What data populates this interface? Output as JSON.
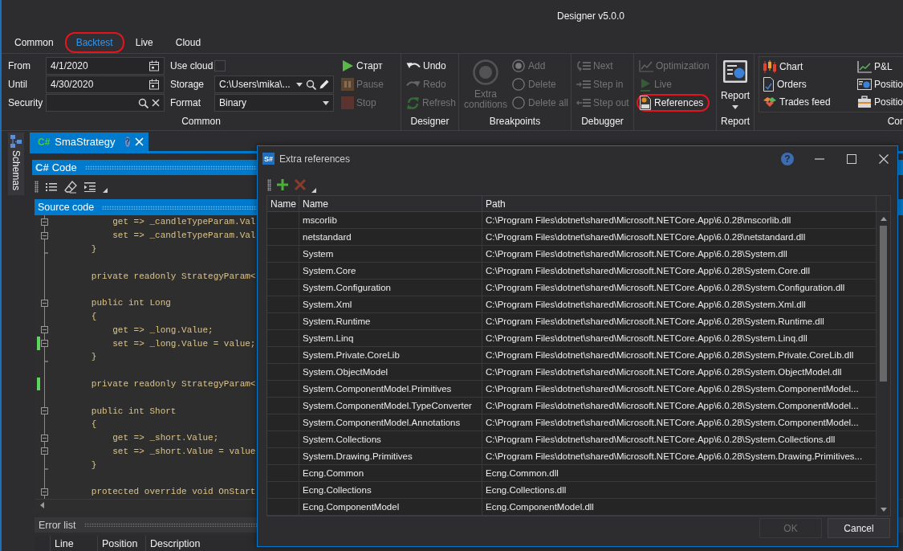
{
  "window": {
    "title": "Designer v5.0.0"
  },
  "ribbon": {
    "tabs": [
      {
        "label": "Common",
        "selected": false,
        "highlighted": false
      },
      {
        "label": "Backtest",
        "selected": true,
        "highlighted": true
      },
      {
        "label": "Live",
        "selected": false,
        "highlighted": false
      },
      {
        "label": "Cloud",
        "selected": false,
        "highlighted": false
      }
    ],
    "groups": [
      {
        "kind": "settings",
        "label": "Common",
        "fields": [
          {
            "label": "From",
            "kind": "date",
            "value": "4/1/2020"
          },
          {
            "label": "Until",
            "kind": "date",
            "value": "4/30/2020"
          },
          {
            "label": "Security",
            "kind": "lookup"
          }
        ],
        "options": [
          {
            "label": "Use cloud",
            "kind": "checkbox",
            "checked": false
          },
          {
            "label": "Storage",
            "kind": "path",
            "value": "C:\\Users\\mika\\..."
          },
          {
            "label": "Format",
            "kind": "dropdown",
            "value": "Binary"
          }
        ],
        "buttons": [
          {
            "label": "Старт",
            "disabled": false,
            "highlighted": false
          },
          {
            "label": "Pause",
            "disabled": true,
            "highlighted": false
          },
          {
            "label": "Stop",
            "disabled": true,
            "highlighted": false
          }
        ]
      },
      {
        "kind": "commands",
        "label": "Designer",
        "buttons": [
          {
            "label": "Undo",
            "disabled": false,
            "highlighted": false
          },
          {
            "label": "Redo",
            "disabled": true,
            "highlighted": false
          },
          {
            "label": "Refresh",
            "disabled": true,
            "highlighted": false
          }
        ]
      },
      {
        "kind": "breakpoints",
        "label": "Breakpoints",
        "large_button": {
          "label": "Extra conditions",
          "disabled": true
        },
        "radios": [
          {
            "label": "Add",
            "selected": true,
            "disabled": true
          },
          {
            "label": "Delete",
            "selected": false,
            "disabled": true
          },
          {
            "label": "Delete all",
            "selected": false,
            "disabled": true
          }
        ]
      },
      {
        "kind": "commands",
        "label": "Debugger",
        "buttons": [
          {
            "label": "Next",
            "disabled": true,
            "highlighted": false
          },
          {
            "label": "Step in",
            "disabled": true,
            "highlighted": false
          },
          {
            "label": "Step out",
            "disabled": true,
            "highlighted": false
          }
        ]
      },
      {
        "kind": "commands",
        "buttons": [
          {
            "label": "Optimization",
            "disabled": true,
            "highlighted": false
          },
          {
            "label": "Live",
            "disabled": true,
            "highlighted": false
          },
          {
            "label": "References",
            "disabled": false,
            "highlighted": true
          }
        ]
      },
      {
        "kind": "large",
        "label": "Report",
        "button": {
          "label": "Report",
          "dropdown": true
        }
      },
      {
        "kind": "panel",
        "label": "Cor",
        "buttons": [
          {
            "label": "Chart"
          },
          {
            "label": "Orders"
          },
          {
            "label": "Trades feed"
          },
          {
            "label": "P&L"
          },
          {
            "label": "Positio"
          },
          {
            "label": "Positio"
          }
        ]
      }
    ]
  },
  "sidebar": {
    "tab": "Schemas"
  },
  "document_tabs": [
    {
      "badge": "C#",
      "title": "SmaStrategy",
      "help": "?",
      "selected": true
    }
  ],
  "code_panel": {
    "badge": "C#",
    "title": "Code"
  },
  "source_code": {
    "title": "Source code",
    "lines": [
      {
        "text": "            get => _candleTypeParam.Val",
        "foldable": true,
        "fold_end": false,
        "changed": false
      },
      {
        "text": "            set => _candleTypeParam.Val",
        "foldable": true,
        "fold_end": false,
        "changed": false
      },
      {
        "text": "        }",
        "foldable": false,
        "fold_end": true,
        "changed": false
      },
      {
        "foldable": false,
        "fold_end": false,
        "changed": false
      },
      {
        "text": "        private readonly StrategyParam<",
        "foldable": false,
        "fold_end": false,
        "changed": false
      },
      {
        "foldable": false,
        "fold_end": false,
        "changed": false
      },
      {
        "text": "        public int Long",
        "foldable": true,
        "fold_end": false,
        "changed": false
      },
      {
        "text": "        {",
        "foldable": false,
        "fold_end": false,
        "changed": false
      },
      {
        "text": "            get => _long.Value;",
        "foldable": true,
        "fold_end": false,
        "changed": false
      },
      {
        "text": "            set => _long.Value = value;",
        "foldable": true,
        "fold_end": false,
        "changed": true
      },
      {
        "text": "        }",
        "foldable": false,
        "fold_end": true,
        "changed": false
      },
      {
        "foldable": false,
        "fold_end": false,
        "changed": false
      },
      {
        "text": "        private readonly StrategyParam<",
        "foldable": false,
        "fold_end": false,
        "changed": true
      },
      {
        "foldable": false,
        "fold_end": false,
        "changed": false
      },
      {
        "text": "        public int Short",
        "foldable": true,
        "fold_end": false,
        "changed": false
      },
      {
        "text": "        {",
        "foldable": false,
        "fold_end": false,
        "changed": false
      },
      {
        "text": "            get => _short.Value;",
        "foldable": true,
        "fold_end": false,
        "changed": false
      },
      {
        "text": "            set => _short.Value = value",
        "foldable": true,
        "fold_end": false,
        "changed": false
      },
      {
        "text": "        }",
        "foldable": false,
        "fold_end": true,
        "changed": false
      },
      {
        "foldable": false,
        "fold_end": false,
        "changed": false
      },
      {
        "text": "        protected override void OnStart",
        "foldable": true,
        "fold_end": false,
        "changed": false
      }
    ]
  },
  "error_list": {
    "title": "Error list",
    "columns": [
      "Line",
      "Position",
      "Description"
    ]
  },
  "dialog": {
    "badge": "S#",
    "title": "Extra references",
    "help": "?",
    "columns": [
      "Name",
      "Name",
      "Path"
    ],
    "rows": [
      {
        "name": "mscorlib",
        "path": "C:\\Program Files\\dotnet\\shared\\Microsoft.NETCore.App\\6.0.28\\mscorlib.dll"
      },
      {
        "name": "netstandard",
        "path": "C:\\Program Files\\dotnet\\shared\\Microsoft.NETCore.App\\6.0.28\\netstandard.dll"
      },
      {
        "name": "System",
        "path": "C:\\Program Files\\dotnet\\shared\\Microsoft.NETCore.App\\6.0.28\\System.dll"
      },
      {
        "name": "System.Core",
        "path": "C:\\Program Files\\dotnet\\shared\\Microsoft.NETCore.App\\6.0.28\\System.Core.dll"
      },
      {
        "name": "System.Configuration",
        "path": "C:\\Program Files\\dotnet\\shared\\Microsoft.NETCore.App\\6.0.28\\System.Configuration.dll"
      },
      {
        "name": "System.Xml",
        "path": "C:\\Program Files\\dotnet\\shared\\Microsoft.NETCore.App\\6.0.28\\System.Xml.dll"
      },
      {
        "name": "System.Runtime",
        "path": "C:\\Program Files\\dotnet\\shared\\Microsoft.NETCore.App\\6.0.28\\System.Runtime.dll"
      },
      {
        "name": "System.Linq",
        "path": "C:\\Program Files\\dotnet\\shared\\Microsoft.NETCore.App\\6.0.28\\System.Linq.dll"
      },
      {
        "name": "System.Private.CoreLib",
        "path": "C:\\Program Files\\dotnet\\shared\\Microsoft.NETCore.App\\6.0.28\\System.Private.CoreLib.dll"
      },
      {
        "name": "System.ObjectModel",
        "path": "C:\\Program Files\\dotnet\\shared\\Microsoft.NETCore.App\\6.0.28\\System.ObjectModel.dll"
      },
      {
        "name": "System.ComponentModel.Primitives",
        "path": "C:\\Program Files\\dotnet\\shared\\Microsoft.NETCore.App\\6.0.28\\System.ComponentModel..."
      },
      {
        "name": "System.ComponentModel.TypeConverter",
        "path": "C:\\Program Files\\dotnet\\shared\\Microsoft.NETCore.App\\6.0.28\\System.ComponentModel..."
      },
      {
        "name": "System.ComponentModel.Annotations",
        "path": "C:\\Program Files\\dotnet\\shared\\Microsoft.NETCore.App\\6.0.28\\System.ComponentModel..."
      },
      {
        "name": "System.Collections",
        "path": "C:\\Program Files\\dotnet\\shared\\Microsoft.NETCore.App\\6.0.28\\System.Collections.dll"
      },
      {
        "name": "System.Drawing.Primitives",
        "path": "C:\\Program Files\\dotnet\\shared\\Microsoft.NETCore.App\\6.0.28\\System.Drawing.Primitives..."
      },
      {
        "name": "Ecng.Common",
        "path": "Ecng.Common.dll"
      },
      {
        "name": "Ecng.Collections",
        "path": "Ecng.Collections.dll"
      },
      {
        "name": "Ecng.ComponentModel",
        "path": "Ecng.ComponentModel.dll"
      }
    ],
    "buttons": [
      {
        "label": "OK",
        "disabled": true
      },
      {
        "label": "Cancel",
        "disabled": false
      }
    ]
  }
}
